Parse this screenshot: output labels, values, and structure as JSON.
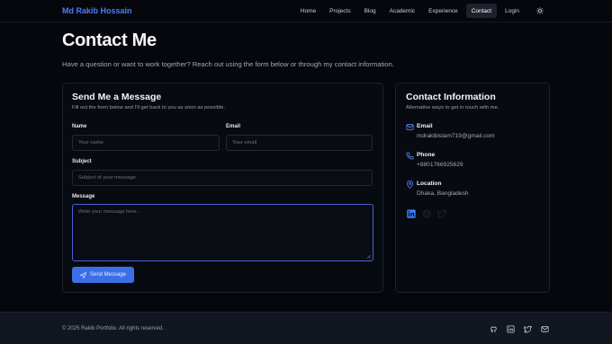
{
  "brand": "Md Rakib Hossain",
  "nav": {
    "items": [
      "Home",
      "Projects",
      "Blog",
      "Academic",
      "Experience",
      "Contact",
      "Login"
    ],
    "active": "Contact",
    "theme_icon": "sun-icon"
  },
  "header": {
    "title": "Contact Me",
    "subtitle": "Have a question or want to work together? Reach out using the form below or through my contact information."
  },
  "form": {
    "title": "Send Me a Message",
    "subtitle": "Fill out the form below and I'll get back to you as soon as possible.",
    "name_label": "Name",
    "name_placeholder": "Your name",
    "email_label": "Email",
    "email_placeholder": "Your email",
    "subject_label": "Subject",
    "subject_placeholder": "Subject of your message",
    "message_label": "Message",
    "message_placeholder": "Write your message here...",
    "send_label": "Send Message"
  },
  "contact_info": {
    "title": "Contact Information",
    "subtitle": "Alternative ways to get in touch with me.",
    "email_label": "Email",
    "email_value": "mdrakibislam719@gmail.com",
    "phone_label": "Phone",
    "phone_value": "+8801766925629",
    "location_label": "Location",
    "location_value": "Dhaka, Bangladesh",
    "socials": [
      "linkedin-icon",
      "github-icon",
      "twitter-icon"
    ]
  },
  "footer": {
    "copyright": "© 2025 Rakib Portfolio. All rights reserved.",
    "icons": [
      "github-icon",
      "linkedin-icon",
      "twitter-icon",
      "mail-icon"
    ]
  },
  "colors": {
    "background": "#05070d",
    "accent": "#3b6fe6",
    "brand": "#4f7df3",
    "card_border": "#1d2230",
    "footer_bg": "#111620"
  }
}
